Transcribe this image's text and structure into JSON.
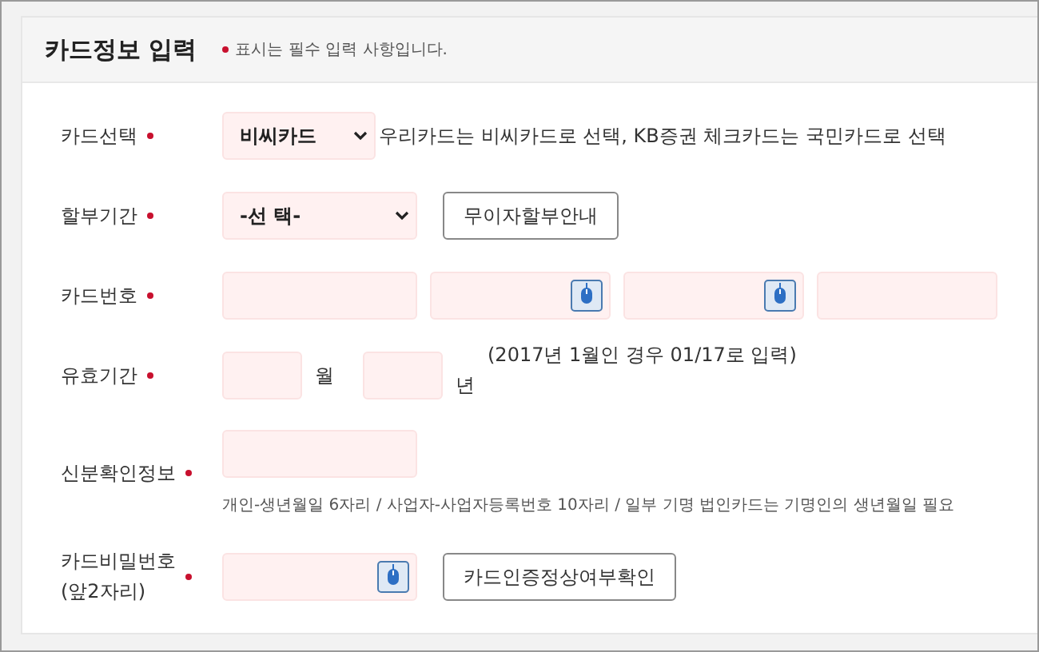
{
  "header": {
    "title": "카드정보 입력",
    "required_mark": true,
    "note": "표시는 필수 입력 사항입니다."
  },
  "rows": [
    {
      "kind": "select",
      "label": [
        "카드선택"
      ],
      "required": true,
      "value": "비씨카드",
      "note": "우리카드는 비씨카드로 선택, KB증권 체크카드는 국민카드로 선택"
    },
    {
      "kind": "select",
      "label": [
        "할부기간"
      ],
      "required": true,
      "value": "-선 택-",
      "button": "무이자할부안내"
    },
    {
      "kind": "card_number",
      "label": [
        "카드번호"
      ],
      "required": true,
      "fields": [
        {
          "keypad": false
        },
        {
          "keypad": true
        },
        {
          "keypad": true
        },
        {
          "keypad": false
        }
      ]
    },
    {
      "kind": "expiry",
      "label": [
        "유효기간"
      ],
      "required": true,
      "month_unit": "월",
      "year_unit": "년",
      "note": "(2017년 1월인 경우 01/17로 입력)"
    },
    {
      "kind": "text",
      "label": [
        "신분확인정보"
      ],
      "required": true,
      "hint": "개인-생년월일 6자리 / 사업자-사업자등록번호 10자리 / 일부 기명 법인카드는 기명인의 생년월일 필요"
    },
    {
      "kind": "password",
      "label": [
        "카드비밀번호",
        "(앞2자리)"
      ],
      "required": true,
      "keypad": true,
      "button": "카드인증정상여부확인"
    }
  ]
}
